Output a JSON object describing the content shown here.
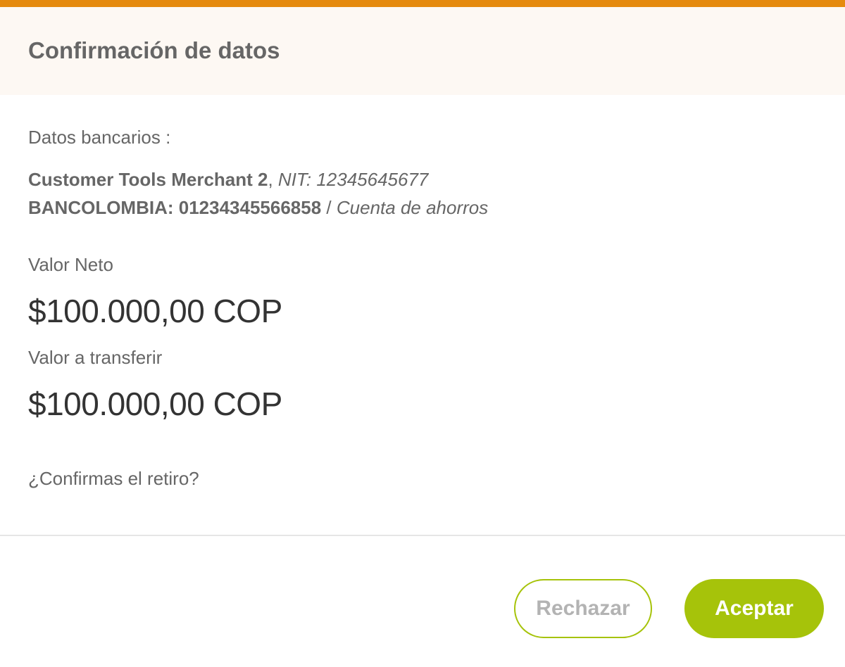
{
  "colors": {
    "accent_top": "#e58a0e",
    "header_bg": "#fdf8f3",
    "button_green": "#a6c30a",
    "text_gray": "#666666",
    "amount_dark": "#333333"
  },
  "dialog": {
    "title": "Confirmación de datos"
  },
  "bank": {
    "section_label": "Datos bancarios :",
    "merchant_name": "Customer Tools Merchant 2",
    "separator_1": ", ",
    "nit": "NIT: 12345645677",
    "bank_account": "BANCOLOMBIA: 01234345566858",
    "separator_2": " / ",
    "account_type": "Cuenta de ahorros"
  },
  "amounts": {
    "net_label": "Valor Neto",
    "net_value": "$100.000,00 COP",
    "transfer_label": "Valor a transferir",
    "transfer_value": "$100.000,00 COP"
  },
  "question": "¿Confirmas el retiro?",
  "buttons": {
    "reject_label": "Rechazar",
    "accept_label": "Aceptar"
  }
}
